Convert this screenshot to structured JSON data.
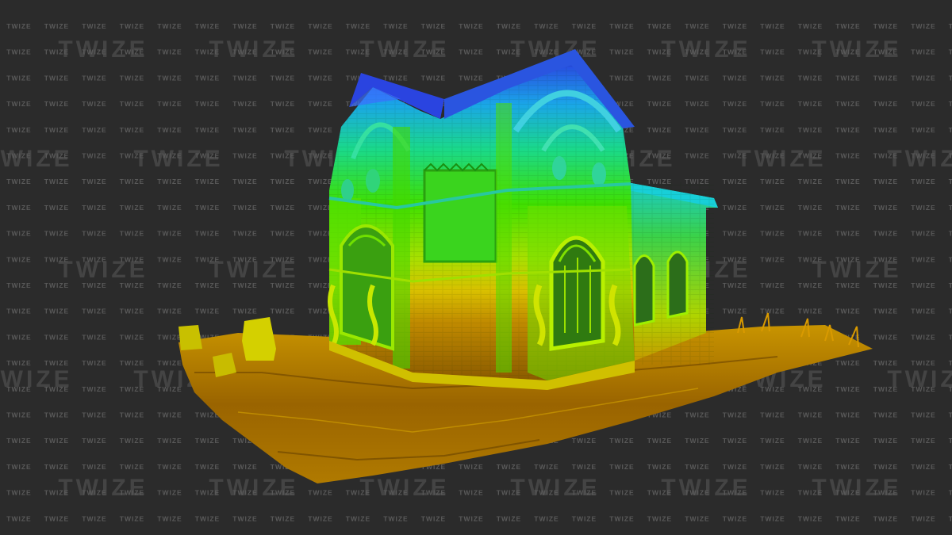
{
  "watermark": {
    "text_small": "TWIZE",
    "text_large": "TWIZE",
    "color": "#5a5a5a"
  },
  "scene": {
    "subject": "point-cloud-building",
    "colormap": [
      "#1f3fd8",
      "#19b8e6",
      "#1fd97a",
      "#6fe000",
      "#b8e000",
      "#d9b000",
      "#b07a00"
    ],
    "background": "#2b2b2b"
  }
}
